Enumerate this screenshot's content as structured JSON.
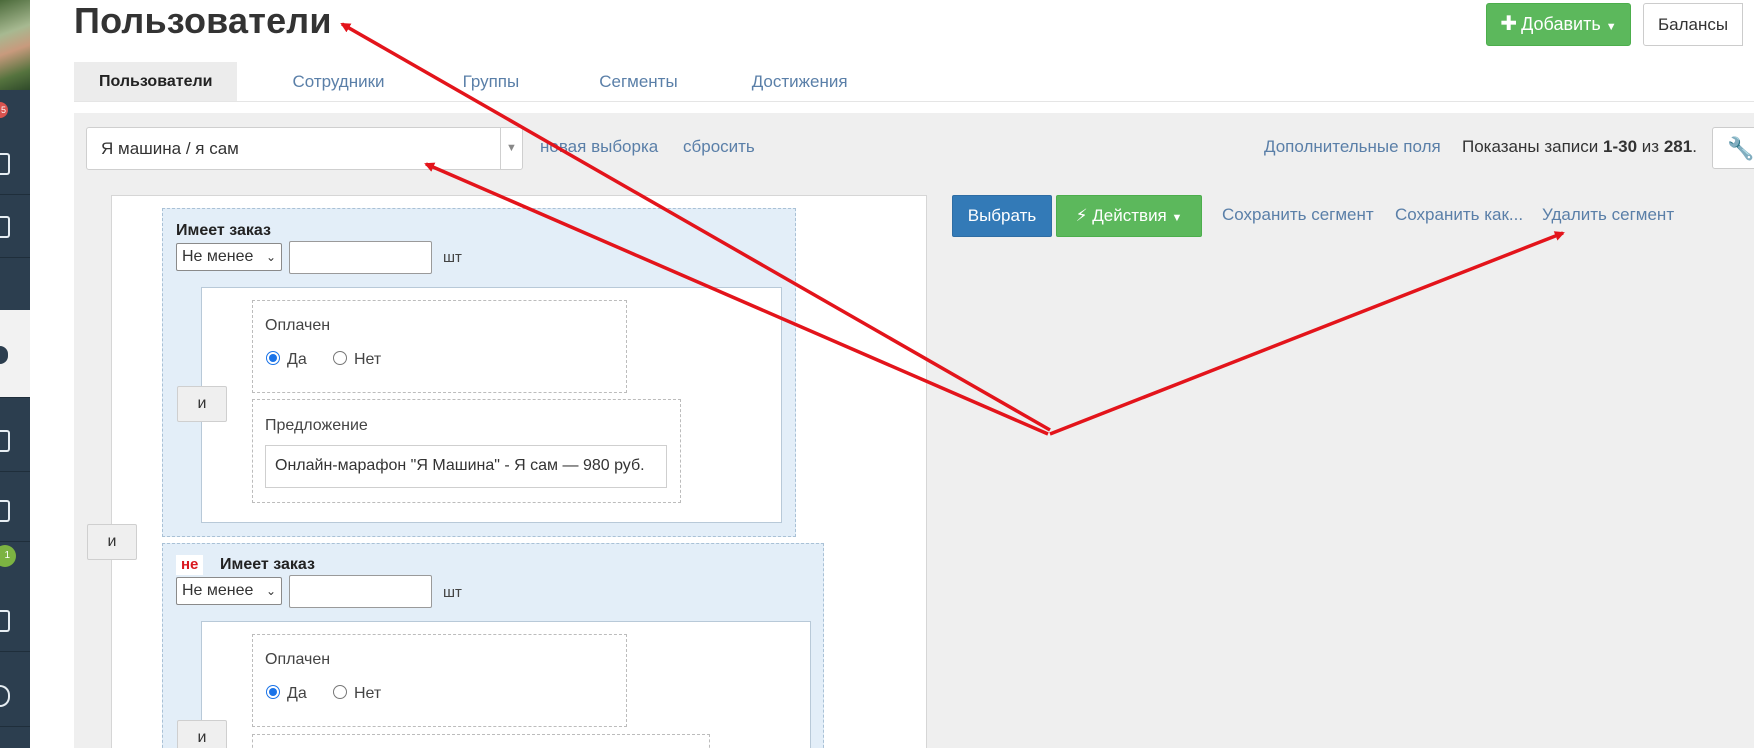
{
  "page": {
    "title": "Пользователи",
    "add_label": "Добавить",
    "balances_label": "Балансы"
  },
  "sidebar": {
    "badge_red": "5",
    "badge_green": "1"
  },
  "tabs": [
    {
      "label": "Пользователи",
      "active": true
    },
    {
      "label": "Сотрудники"
    },
    {
      "label": "Группы"
    },
    {
      "label": "Сегменты"
    },
    {
      "label": "Достижения"
    }
  ],
  "filterbar": {
    "segment_value": "Я машина / я сам",
    "new_selection": "новая выборка",
    "reset": "сбросить",
    "extra_fields": "Дополнительные поля",
    "records_prefix": "Показаны записи",
    "records_range": "1-30",
    "records_of": "из",
    "records_total": "281",
    "records_suffix": "."
  },
  "actions": {
    "choose": "Выбрать",
    "actions_label": "Действия",
    "save_segment": "Сохранить сегмент",
    "save_as": "Сохранить как...",
    "delete_segment": "Удалить сегмент"
  },
  "builder": {
    "and_label": "и",
    "condition1": {
      "title": "Имеет заказ",
      "operator": "Не менее",
      "unit": "шт",
      "paid_label": "Оплачен",
      "yes": "Да",
      "no": "Нет",
      "offer_label": "Предложение",
      "offer_value": "Онлайн-марафон \"Я Машина\" - Я сам — 980 руб."
    },
    "condition2": {
      "neg": "не",
      "title": "Имеет заказ",
      "operator": "Не менее",
      "unit": "шт",
      "paid_label": "Оплачен",
      "yes": "Да",
      "no": "Нет"
    }
  },
  "colors": {
    "sidebar": "#2c3e4f",
    "primary": "#337ab7",
    "success": "#5cb85c",
    "link": "#5a7fa8",
    "annotation": "#e3141b"
  }
}
